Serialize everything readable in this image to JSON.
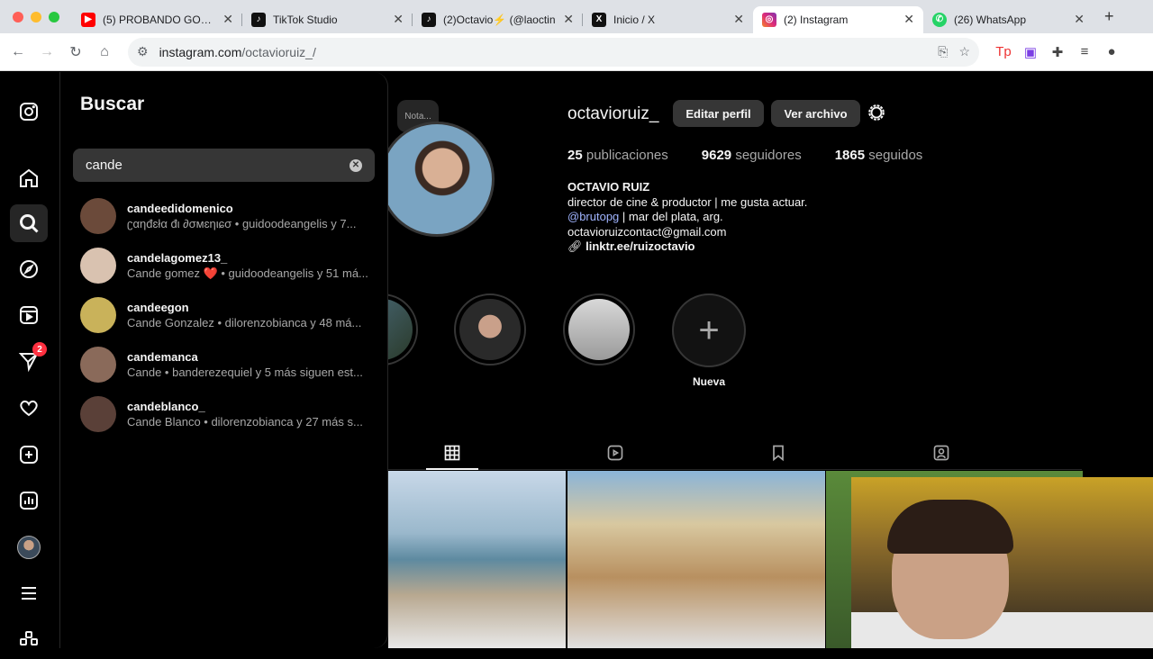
{
  "browser": {
    "tabs": [
      {
        "title": "(5) PROBANDO GOLOS",
        "favicon": "youtube-icon",
        "color": "#ff0000"
      },
      {
        "title": "TikTok Studio",
        "favicon": "tiktok-icon",
        "color": "#111111"
      },
      {
        "title": "(2)Octavio⚡ (@laoctin",
        "favicon": "tiktok-icon",
        "color": "#111111"
      },
      {
        "title": "Inicio / X",
        "favicon": "x-icon",
        "color": "#111111"
      },
      {
        "title": "(2) Instagram",
        "favicon": "instagram-icon",
        "color": "#e1306c",
        "active": true
      },
      {
        "title": "(26) WhatsApp",
        "favicon": "whatsapp-icon",
        "color": "#25d366"
      }
    ],
    "url_host": "instagram.com",
    "url_path": "/octavioruiz_/"
  },
  "search": {
    "title": "Buscar",
    "query": "cande",
    "results": [
      {
        "username": "candeedidomenico",
        "subtitle": "ʗαηđɛłα đι ∂σмɛηιɕσ • guidoodeangelis y 7...",
        "avatar_color": "#6b4a3a"
      },
      {
        "username": "candelagomez13_",
        "subtitle": "Cande gomez ❤️ • guidoodeangelis y 51 má...",
        "avatar_color": "#d9c2b0"
      },
      {
        "username": "candeegon",
        "subtitle": "Cande Gonzalez • dilorenzobianca y 48 má...",
        "avatar_color": "#c9b25a"
      },
      {
        "username": "candemanca",
        "subtitle": "Cande • banderezequiel y 5 más siguen est...",
        "avatar_color": "#8a6a5a"
      },
      {
        "username": "candeblanco_",
        "subtitle": "Cande Blanco • dilorenzobianca y 27 más s...",
        "avatar_color": "#5a4038"
      }
    ]
  },
  "rail": {
    "notification_count": "2"
  },
  "profile": {
    "note": "Nota...",
    "username": "octavioruiz_",
    "edit_button": "Editar perfil",
    "archive_button": "Ver archivo",
    "stats": {
      "posts_count": "25",
      "posts_label": "publicaciones",
      "followers_count": "9629",
      "followers_label": "seguidores",
      "following_count": "1865",
      "following_label": "seguidos"
    },
    "bio": {
      "name": "OCTAVIO RUIZ",
      "line1": "director de cine & productor | me gusta actuar.",
      "mention": "@brutopg",
      "line2_rest": " | mar del plata, arg.",
      "email": "octavioruizcontact@gmail.com",
      "link": "linktr.ee/ruizoctavio"
    },
    "highlights_new_label": "Nueva"
  }
}
